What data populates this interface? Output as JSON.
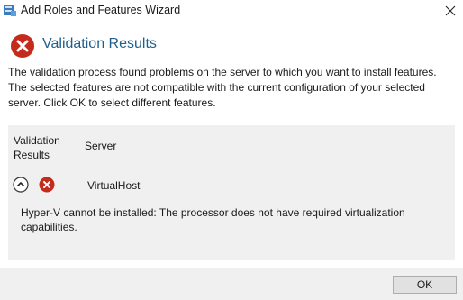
{
  "window": {
    "title": "Add Roles and Features Wizard"
  },
  "dialog": {
    "heading": "Validation Results",
    "description_lines": [
      "The validation process found problems on the server to which you want to install features.",
      "The selected features are not compatible with the current configuration of your selected",
      "server.  Click OK to select different features."
    ]
  },
  "results": {
    "columns": {
      "validation_results_line1": "Validation",
      "validation_results_line2": "Results",
      "server": "Server"
    },
    "rows": [
      {
        "server": "VirtualHost",
        "status": "error",
        "message": "Hyper-V cannot be installed: The processor does not have required virtualization capabilities."
      }
    ]
  },
  "buttons": {
    "ok_label": "OK"
  },
  "icons": {
    "title_icon": "server-manager-icon",
    "status_icon": "error-x-icon",
    "expand_icon": "chevron-up-icon",
    "close_icon": "close-icon"
  },
  "colors": {
    "heading": "#1f5f8b",
    "error": "#c42b1c"
  }
}
